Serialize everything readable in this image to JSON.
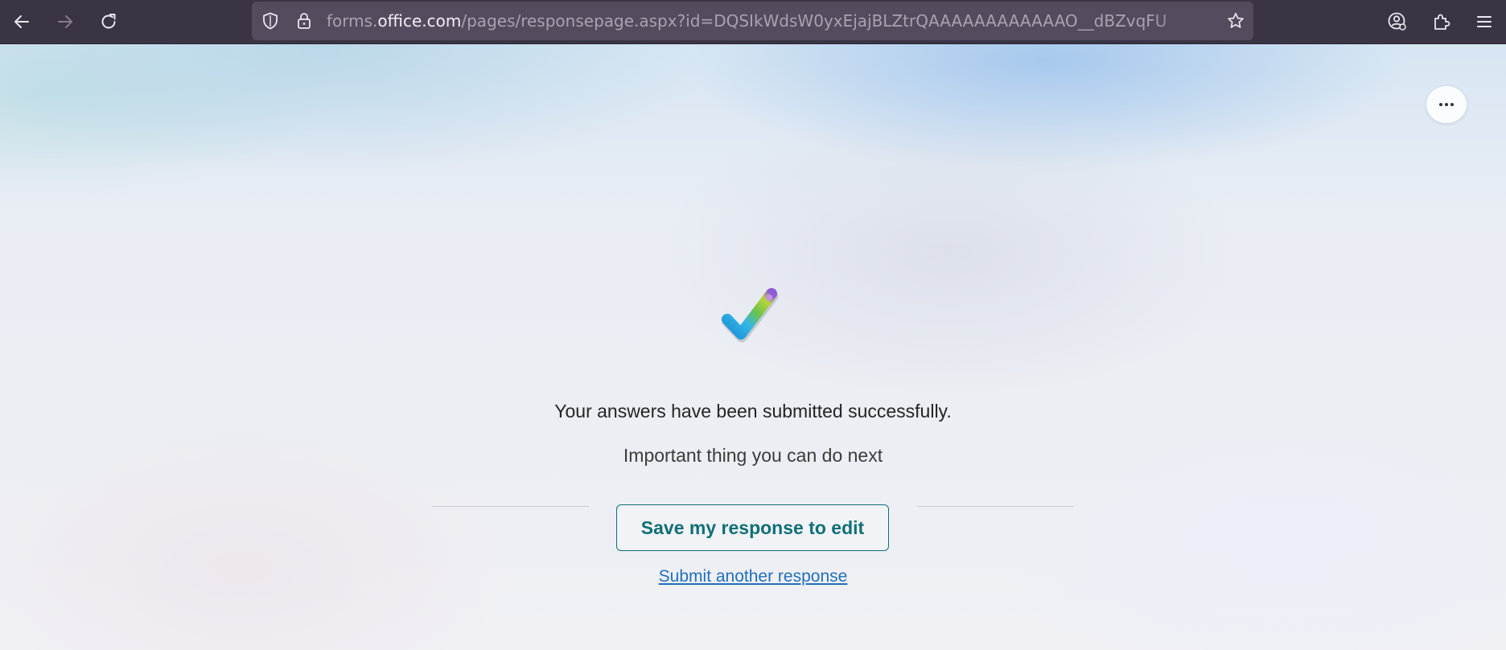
{
  "browser": {
    "url_scheme_part": "forms.",
    "url_host": "office.com",
    "url_rest": "/pages/responsepage.aspx?id=DQSIkWdsW0yxEjajBLZtrQAAAAAAAAAAAAO__dBZvqFU"
  },
  "page": {
    "success_message": "Your answers have been submitted successfully.",
    "next_heading": "Important thing you can do next",
    "save_button_label": "Save my response to edit",
    "submit_another_label": "Submit another response"
  },
  "colors": {
    "accent_teal": "#0f6f76",
    "link_blue": "#1f6fbf",
    "toolbar_bg": "#3b3444"
  },
  "icons": {
    "back": "back-arrow-icon",
    "forward": "forward-arrow-icon",
    "reload": "reload-icon",
    "shield": "shield-icon",
    "lock": "lock-icon",
    "bookmark": "star-icon",
    "account": "account-icon",
    "extensions": "puzzle-icon",
    "menu": "hamburger-menu-icon",
    "more": "more-options-icon",
    "success": "checkmark-icon"
  }
}
